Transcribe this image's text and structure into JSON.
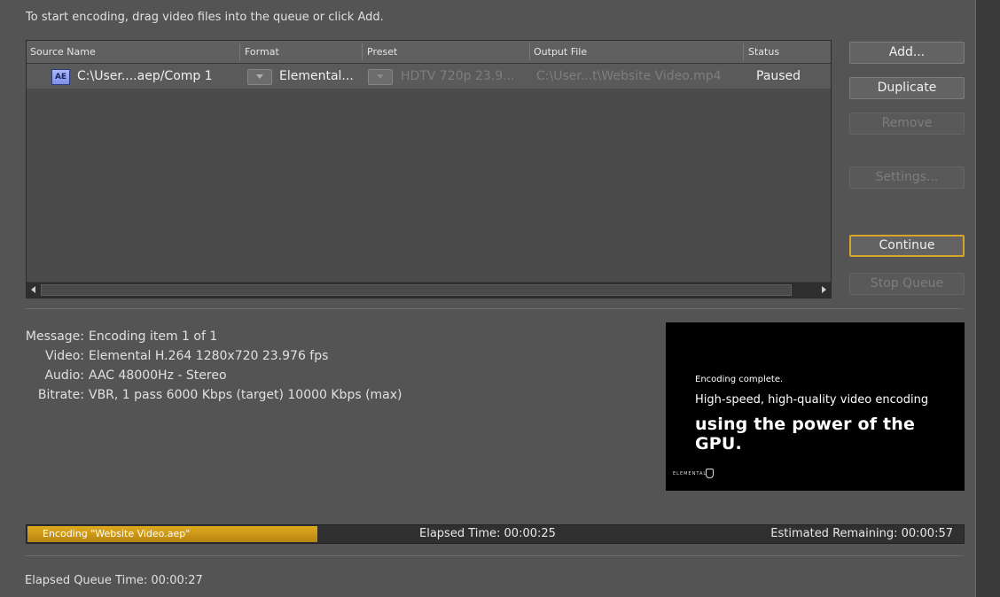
{
  "hint": "To start encoding, drag video files into the queue or click Add.",
  "queue": {
    "columns": [
      "Source Name",
      "Format",
      "Preset",
      "Output File",
      "Status"
    ],
    "items": [
      {
        "source": "C:\\User....aep/Comp 1",
        "source_icon": "AE",
        "format": "Elemental...",
        "preset": "HDTV 720p 23.9...",
        "output": "C:\\User...t\\Website Video.mp4",
        "status": "Paused"
      }
    ]
  },
  "buttons": {
    "add": "Add...",
    "duplicate": "Duplicate",
    "remove": "Remove",
    "settings": "Settings...",
    "continue": "Continue",
    "stop": "Stop Queue"
  },
  "info": {
    "message_label": "Message:",
    "message": "Encoding item 1 of 1",
    "video_label": "Video:",
    "video": "Elemental H.264 1280x720 23.976 fps",
    "audio_label": "Audio:",
    "audio": "AAC 48000Hz - Stereo",
    "bitrate_label": "Bitrate:",
    "bitrate": "VBR, 1 pass 6000 Kbps (target) 10000 Kbps (max)"
  },
  "preview": {
    "line1": "Encoding complete.",
    "line2": "High-speed, high-quality video encoding",
    "line3": "using the power of the GPU.",
    "logo": "ELEMENTAL"
  },
  "progress": {
    "fraction": 0.31,
    "label": "Encoding \"Website Video.aep\"",
    "elapsed": "Elapsed Time: 00:00:25",
    "remaining": "Estimated Remaining: 00:00:57",
    "color": "#d49c18"
  },
  "queue_time": "Elapsed Queue Time:  00:00:27"
}
